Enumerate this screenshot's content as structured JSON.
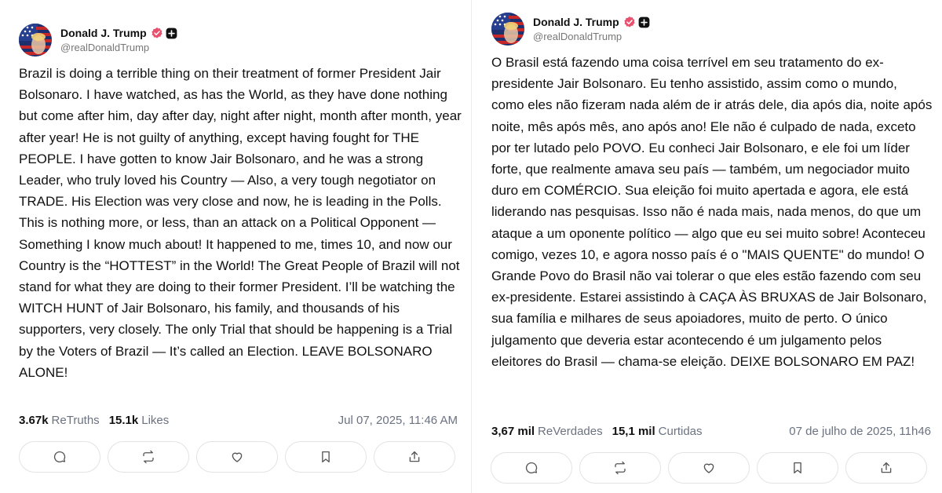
{
  "posts": [
    {
      "author": {
        "name": "Donald J. Trump",
        "handle": "@realDonaldTrump"
      },
      "text": "Brazil is doing a terrible thing on their treatment of former President Jair Bolsonaro. I have watched, as has the World, as they have done nothing but come after him, day after day, night after night, month after month, year after year! He is not guilty of anything, except having fought for THE PEOPLE. I have gotten to know Jair Bolsonaro, and he was a strong Leader, who truly loved his Country — Also, a very tough negotiator on TRADE. His Election was very close and now, he is leading in the Polls. This is nothing more, or less, than an attack on a Political Opponent — Something I know much about! It happened to me, times 10, and now our Country is the “HOTTEST” in the World! The Great People of Brazil will not stand for what they are doing to their former President. I’ll be watching the WITCH HUNT of Jair Bolsonaro, his family, and thousands of his supporters, very closely. The only Trial that should be happening is a Trial by the Voters of Brazil — It’s called an Election. LEAVE BOLSONARO ALONE!",
      "stats": {
        "retruths_count": "3.67k",
        "retruths_label": "ReTruths",
        "likes_count": "15.1k",
        "likes_label": "Likes"
      },
      "timestamp": "Jul 07, 2025, 11:46 AM"
    },
    {
      "author": {
        "name": "Donald J. Trump",
        "handle": "@realDonaldTrump"
      },
      "text": "O Brasil está fazendo uma coisa terrível em seu tratamento do ex-presidente Jair Bolsonaro. Eu tenho assistido, assim como o mundo, como eles não fizeram nada além de ir atrás dele, dia após dia, noite após noite, mês após mês, ano após ano! Ele não é culpado de nada, exceto por ter lutado pelo POVO. Eu conheci Jair Bolsonaro, e ele foi um líder forte, que realmente amava seu país — também, um negociador muito duro em COMÉRCIO. Sua eleição foi muito apertada e agora, ele está liderando nas pesquisas. Isso não é nada mais, nada menos, do que um ataque a um oponente político — algo que eu sei muito sobre! Aconteceu comigo, vezes 10, e agora nosso país é o \"MAIS QUENTE\" do mundo! O Grande Povo do Brasil não vai tolerar o que eles estão fazendo com seu ex-presidente. Estarei assistindo à CAÇA ÀS BRUXAS de Jair Bolsonaro, sua família e milhares de seus apoiadores, muito de perto. O único julgamento que deveria estar acontecendo é um julgamento pelos eleitores do Brasil — chama-se eleição. DEIXE BOLSONARO EM PAZ!",
      "stats": {
        "retruths_count": "3,67 mil",
        "retruths_label": "ReVerdades",
        "likes_count": "15,1 mil",
        "likes_label": "Curtidas"
      },
      "timestamp": "07 de julho de 2025, 11h46"
    }
  ],
  "icons": {
    "verified": "verified-badge-icon",
    "plus": "plus-badge-icon",
    "actions": [
      "reply-icon",
      "retruth-icon",
      "like-icon",
      "bookmark-icon",
      "share-icon"
    ]
  },
  "colors": {
    "verified_badge": "#e8506e",
    "muted_text": "#6b7280",
    "border": "#e3e3e3"
  }
}
